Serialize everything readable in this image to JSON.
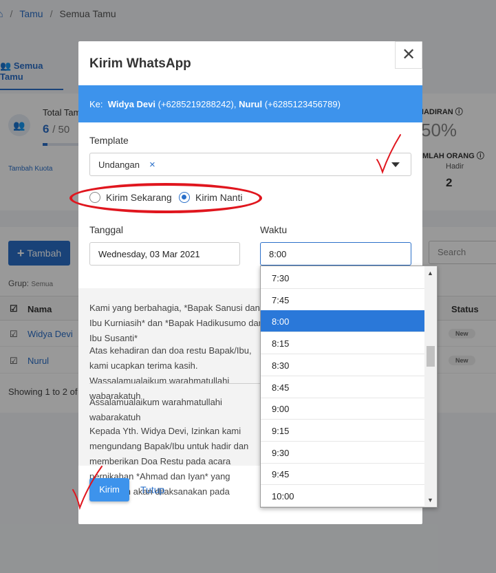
{
  "breadcrumb": {
    "link": "Tamu",
    "current": "Semua Tamu"
  },
  "tabs": {
    "active": "Semua Tamu"
  },
  "stats": {
    "total_label": "Total Tam",
    "total_value": "6",
    "total_max": "/ 50",
    "quota_link": "Tambah Kuota",
    "kehadiran_label": "HADIRAN",
    "kehadiran_pct": "50%",
    "jumlah_label": "MLAH ORANG",
    "hadir_label": "Hadir",
    "hadir_value": "2"
  },
  "table": {
    "add_button": "Tambah",
    "search_placeholder": "Search",
    "group_label": "Grup:",
    "group_value": "Semua",
    "col_name": "Nama",
    "col_status": "Status",
    "rows": [
      {
        "name": "Widya Devi",
        "status": "New"
      },
      {
        "name": "Nurul",
        "status": "New"
      }
    ],
    "showing": "Showing 1 to 2 of"
  },
  "modal": {
    "title": "Kirim WhatsApp",
    "close_glyph": "✕",
    "to_label": "Ke:",
    "recipient_1_name": "Widya Devi",
    "recipient_1_phone": "(+6285219288242),",
    "recipient_2_name": "Nurul",
    "recipient_2_phone": "(+6285123456789)",
    "template_label": "Template",
    "template_value": "Undangan",
    "template_clear": "×",
    "radio_now": "Kirim Sekarang",
    "radio_later": "Kirim Nanti",
    "radio_selected": "Kirim Nanti",
    "date_label": "Tanggal",
    "date_value": "Wednesday, 03 Mar 2021",
    "time_label": "Waktu",
    "time_value": "8:00",
    "message_1": "Kami yang berbahagia, *Bapak Sanusi dan Ibu Kurniasih* dan *Bapak Hadikusumo dan Ibu Susanti*",
    "message_2": "Atas kehadiran dan doa restu Bapak/Ibu, kami ucapkan terima kasih. Wassalamualaikum warahmatullahi wabarakatuh",
    "message_3": "Assalamualaikum warahmatullahi wabarakatuh",
    "message_4": "Kepada Yth. Widya Devi, Izinkan kami mengundang Bapak/Ibu untuk hadir dan memberikan Doa Restu pada acara pernikahan *Ahmad dan Iyan* yang inshaAllah akan dilaksanakan pada",
    "send_button": "Kirim",
    "close_button": "Tutup"
  },
  "time_options": [
    "7:30",
    "7:45",
    "8:00",
    "8:15",
    "8:30",
    "8:45",
    "9:00",
    "9:15",
    "9:30",
    "9:45",
    "10:00"
  ],
  "time_selected": "8:00",
  "colors": {
    "accent": "#2a6fc9",
    "header_bar": "#3d93ec",
    "annotation": "#e0161e"
  }
}
